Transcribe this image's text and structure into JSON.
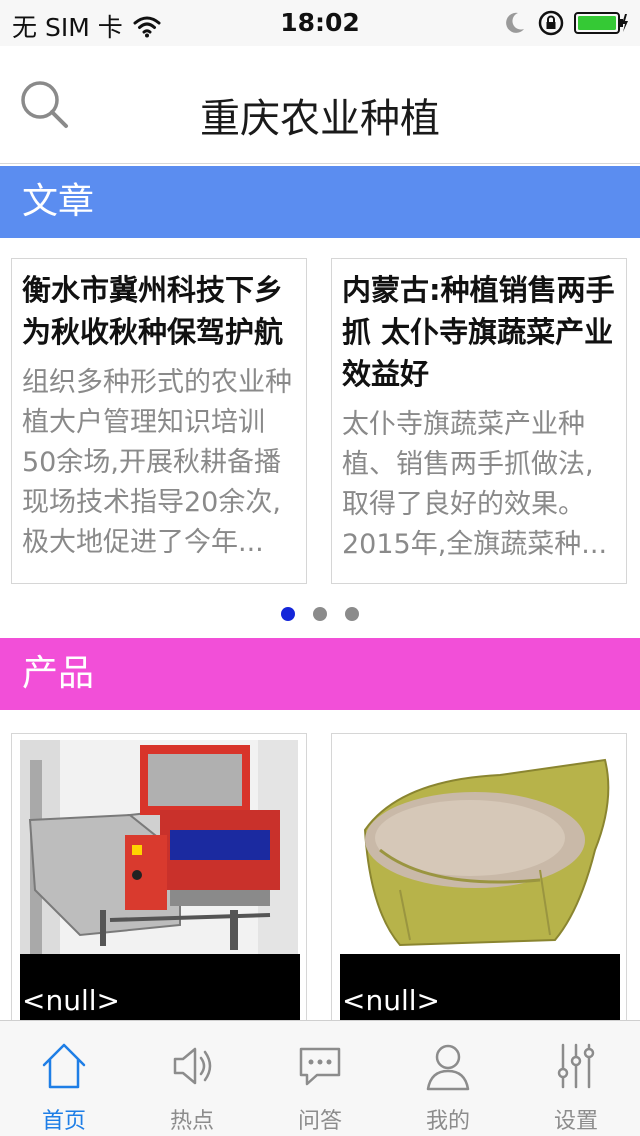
{
  "status_bar": {
    "carrier": "无 SIM 卡",
    "time": "18:02",
    "icons": [
      "wifi-icon",
      "moon-icon",
      "rotation-lock-icon",
      "battery-icon"
    ]
  },
  "header": {
    "title": "重庆农业种植",
    "search_icon": "search-icon"
  },
  "sections": {
    "articles": {
      "label": "文章",
      "color": "#5b8df0"
    },
    "products": {
      "label": "产品",
      "color": "#f24fd8"
    }
  },
  "articles": [
    {
      "title": "衡水市冀州科技下乡为秋收秋种保驾护航",
      "summary": "组织多种形式的农业种植大户管理知识培训50余场,开展秋耕备播现场技术指导20余次,极大地促进了今年..."
    },
    {
      "title": "内蒙古:种植销售两手抓 太仆寺旗蔬菜产业效益好",
      "summary": "太仆寺旗蔬菜产业种植、销售两手抓做法,取得了良好的效果。2015年,全旗蔬菜种..."
    }
  ],
  "pager": {
    "count": 3,
    "active_index": 0,
    "active_color": "#1426d9",
    "inactive_color": "#8b8b8b"
  },
  "products": [
    {
      "caption": "<null>",
      "image": "machine-image"
    },
    {
      "caption": "<null>",
      "image": "sack-image"
    }
  ],
  "tab_bar": {
    "active_color": "#1e7ee6",
    "tabs": [
      {
        "label": "首页",
        "icon": "home-icon",
        "active": true
      },
      {
        "label": "热点",
        "icon": "speaker-icon",
        "active": false
      },
      {
        "label": "问答",
        "icon": "chat-icon",
        "active": false
      },
      {
        "label": "我的",
        "icon": "user-icon",
        "active": false
      },
      {
        "label": "设置",
        "icon": "settings-icon",
        "active": false
      }
    ]
  }
}
